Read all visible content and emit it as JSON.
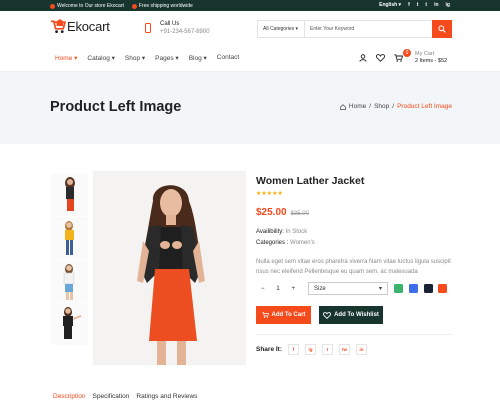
{
  "topbar": {
    "welcome": "Welcome to Our store Ekocart",
    "shipping": "Free shipping worldwide",
    "language": "English",
    "social": [
      "f",
      "t",
      "t",
      "in",
      "ig"
    ]
  },
  "header": {
    "logo_text": "Ekocart",
    "call_label": "Call Us",
    "phone": "+91-234-567-8900",
    "search_category": "All Categories",
    "search_placeholder": "Enter Your Keyword"
  },
  "nav": {
    "items": [
      "Home",
      "Catalog",
      "Shop",
      "Pages",
      "Blog",
      "Contact"
    ],
    "active_item": "Home",
    "cart_count": "0",
    "cart_label": "My Cart",
    "cart_summary": "2 Items - $52"
  },
  "banner": {
    "title": "Product Left Image",
    "crumbs": [
      "Home",
      "/",
      "Shop",
      "/",
      "Product Left Image"
    ]
  },
  "product": {
    "title": "Women Lather Jacket",
    "stars": "★★★★★",
    "rating": 5,
    "price": "$25.00",
    "old_price": "$35.00",
    "availability_label": "Availibility:",
    "availability_value": "In Stock",
    "categories_label": "Categories :",
    "categories_value": "Women's",
    "description": "Nulla eget sem vitae eros pharetra viverra Nam vitae luctus ligula suscipit risus nec eleifend Pellentesque eu quam sem, ac malesuada",
    "qty_minus": "−",
    "quantity": "1",
    "qty_plus": "+",
    "size_placeholder": "Size",
    "colors": [
      "#3bb46b",
      "#3d6ee8",
      "#172330",
      "#f44a1c"
    ],
    "add_to_cart": "Add To Cart",
    "add_to_wishlist": "Add To Wishlist",
    "share_label": "Share It:",
    "share_icons": [
      "f",
      "ig",
      "t",
      "tw",
      "in"
    ]
  },
  "tabs": {
    "items": [
      "Description",
      "Specification",
      "Ratings and Reviews"
    ],
    "active": "Description"
  },
  "colors": {
    "accent": "#f44a1c",
    "dark": "#17342d",
    "banner_bg": "#f3f6f8"
  }
}
